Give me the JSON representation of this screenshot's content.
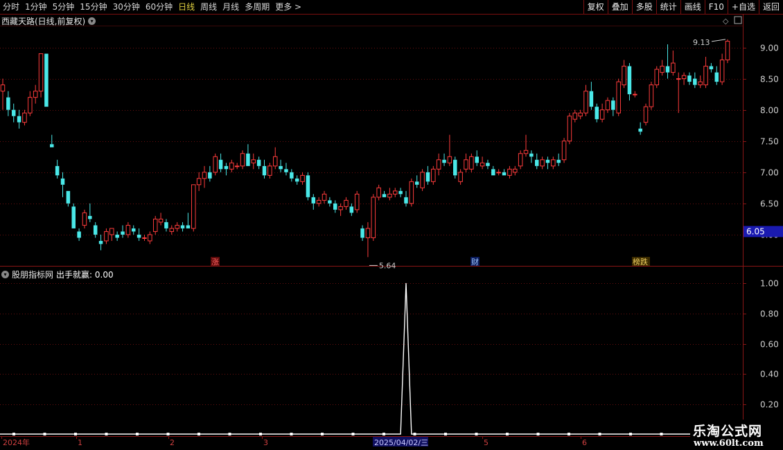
{
  "toolbar": {
    "periods": [
      "分时",
      "1分钟",
      "5分钟",
      "15分钟",
      "30分钟",
      "60分钟",
      "日线",
      "周线",
      "月线",
      "多周期",
      "更多 >"
    ],
    "active_period": "日线",
    "right_buttons": [
      "复权",
      "叠加",
      "多股",
      "统计",
      "画线",
      "F10",
      "+自选",
      "返回"
    ]
  },
  "main_title": "西藏天路(日线,前复权)",
  "indicator_title": "股朋指标网",
  "indicator_name": "出手就赢: 0.00",
  "price_axis": [
    "9.00",
    "8.50",
    "8.00",
    "7.50",
    "7.00",
    "6.50",
    "6.00"
  ],
  "current_price": "6.05",
  "high_label": "9.13",
  "low_label": "5.64",
  "markers": [
    "涨",
    "财",
    "榜跌"
  ],
  "ind_axis": [
    "1.00",
    "0.80",
    "0.60",
    "0.40",
    "0.20"
  ],
  "date_labels": [
    "2024年",
    "1",
    "2",
    "3",
    "2025/04/02/三",
    "5",
    "6"
  ],
  "logo": {
    "name": "乐淘公式网",
    "url": "www.60lt.com"
  },
  "colors": {
    "up": "#ff3c3c",
    "down": "#4ae8e8",
    "grid": "#6a0f0f",
    "bg": "#000000",
    "signal": "#ffffff"
  },
  "chart_data": {
    "type": "candlestick",
    "ohlc": [
      [
        8.3,
        8.5,
        8.0,
        8.4
      ],
      [
        8.2,
        8.3,
        7.9,
        8.0
      ],
      [
        8.0,
        8.1,
        7.8,
        7.9
      ],
      [
        7.9,
        8.0,
        7.7,
        7.8
      ],
      [
        7.8,
        8.0,
        7.75,
        7.95
      ],
      [
        7.95,
        8.3,
        7.9,
        8.2
      ],
      [
        8.2,
        8.4,
        8.1,
        8.3
      ],
      [
        8.3,
        8.9,
        8.2,
        8.9
      ],
      [
        8.9,
        8.9,
        8.05,
        8.05
      ],
      [
        7.45,
        7.6,
        7.4,
        7.4
      ],
      [
        7.1,
        7.2,
        6.9,
        6.95
      ],
      [
        6.9,
        7.0,
        6.6,
        6.8
      ],
      [
        6.7,
        6.7,
        6.45,
        6.5
      ],
      [
        6.45,
        6.5,
        6.1,
        6.1
      ],
      [
        6.05,
        6.1,
        5.9,
        5.95
      ],
      [
        6.15,
        6.4,
        6.1,
        6.35
      ],
      [
        6.3,
        6.5,
        6.2,
        6.25
      ],
      [
        6.15,
        6.2,
        5.95,
        6.0
      ],
      [
        5.9,
        6.0,
        5.75,
        5.85
      ],
      [
        5.9,
        6.1,
        5.85,
        6.05
      ],
      [
        6.0,
        6.1,
        5.9,
        6.1
      ],
      [
        6.0,
        6.05,
        5.9,
        5.95
      ],
      [
        6.05,
        6.15,
        5.95,
        6.0
      ],
      [
        6.0,
        6.2,
        5.95,
        6.15
      ],
      [
        6.1,
        6.15,
        6.0,
        6.05
      ],
      [
        6.0,
        6.1,
        5.9,
        5.95
      ],
      [
        5.95,
        6.0,
        5.9,
        5.95
      ],
      [
        5.9,
        6.05,
        5.85,
        6.0
      ],
      [
        6.05,
        6.3,
        6.0,
        6.25
      ],
      [
        6.2,
        6.35,
        6.15,
        6.25
      ],
      [
        6.2,
        6.25,
        6.05,
        6.1
      ],
      [
        6.05,
        6.15,
        6.0,
        6.1
      ],
      [
        6.1,
        6.2,
        6.05,
        6.15
      ],
      [
        6.15,
        6.2,
        6.05,
        6.1
      ],
      [
        6.15,
        6.35,
        6.1,
        6.1
      ],
      [
        6.1,
        6.8,
        6.05,
        6.8
      ],
      [
        6.8,
        7.0,
        6.7,
        6.9
      ],
      [
        6.9,
        7.1,
        6.75,
        7.0
      ],
      [
        7.0,
        7.1,
        6.85,
        6.9
      ],
      [
        7.0,
        7.3,
        6.95,
        7.25
      ],
      [
        7.2,
        7.3,
        7.0,
        7.05
      ],
      [
        7.1,
        7.15,
        6.95,
        7.05
      ],
      [
        7.05,
        7.2,
        7.0,
        7.15
      ],
      [
        7.1,
        7.15,
        7.05,
        7.1
      ],
      [
        7.1,
        7.35,
        7.05,
        7.3
      ],
      [
        7.3,
        7.45,
        7.1,
        7.1
      ],
      [
        7.15,
        7.3,
        7.05,
        7.2
      ],
      [
        7.2,
        7.25,
        7.05,
        7.1
      ],
      [
        7.1,
        7.2,
        6.9,
        6.95
      ],
      [
        6.95,
        7.15,
        6.9,
        7.1
      ],
      [
        7.1,
        7.4,
        7.05,
        7.25
      ],
      [
        7.1,
        7.2,
        7.0,
        7.05
      ],
      [
        7.05,
        7.15,
        6.95,
        7.0
      ],
      [
        7.0,
        7.05,
        6.85,
        6.9
      ],
      [
        6.9,
        6.95,
        6.8,
        6.85
      ],
      [
        6.85,
        7.0,
        6.8,
        6.95
      ],
      [
        6.95,
        7.0,
        6.55,
        6.6
      ],
      [
        6.6,
        6.65,
        6.4,
        6.5
      ],
      [
        6.5,
        6.6,
        6.45,
        6.55
      ],
      [
        6.55,
        6.7,
        6.5,
        6.65
      ],
      [
        6.55,
        6.6,
        6.45,
        6.5
      ],
      [
        6.5,
        6.55,
        6.35,
        6.4
      ],
      [
        6.4,
        6.5,
        6.3,
        6.45
      ],
      [
        6.45,
        6.6,
        6.4,
        6.55
      ],
      [
        6.45,
        6.5,
        6.3,
        6.35
      ],
      [
        6.4,
        6.7,
        6.35,
        6.65
      ],
      [
        6.1,
        6.15,
        5.9,
        5.95
      ],
      [
        5.95,
        6.2,
        5.64,
        6.1
      ],
      [
        5.95,
        6.65,
        5.9,
        6.6
      ],
      [
        6.6,
        6.8,
        6.55,
        6.75
      ],
      [
        6.65,
        6.7,
        6.6,
        6.6
      ],
      [
        6.6,
        6.75,
        6.55,
        6.65
      ],
      [
        6.65,
        6.75,
        6.6,
        6.7
      ],
      [
        6.7,
        6.75,
        6.6,
        6.65
      ],
      [
        6.6,
        6.7,
        6.45,
        6.5
      ],
      [
        6.5,
        6.9,
        6.45,
        6.85
      ],
      [
        6.85,
        6.95,
        6.75,
        6.8
      ],
      [
        6.75,
        7.05,
        6.7,
        7.0
      ],
      [
        7.0,
        7.1,
        6.8,
        6.85
      ],
      [
        6.85,
        7.1,
        6.8,
        7.05
      ],
      [
        7.05,
        7.3,
        6.95,
        7.2
      ],
      [
        7.2,
        7.3,
        7.1,
        7.15
      ],
      [
        7.15,
        7.6,
        7.1,
        7.25
      ],
      [
        7.2,
        7.25,
        6.9,
        6.95
      ],
      [
        6.85,
        7.05,
        6.8,
        7.0
      ],
      [
        7.05,
        7.3,
        7.0,
        7.2
      ],
      [
        7.05,
        7.3,
        7.0,
        7.25
      ],
      [
        7.25,
        7.35,
        7.1,
        7.15
      ],
      [
        7.1,
        7.25,
        7.05,
        7.15
      ],
      [
        7.15,
        7.2,
        7.05,
        7.1
      ],
      [
        7.05,
        7.1,
        6.95,
        6.95
      ],
      [
        7.0,
        7.05,
        6.95,
        7.0
      ],
      [
        7.0,
        7.05,
        6.95,
        6.95
      ],
      [
        6.95,
        7.1,
        6.9,
        7.05
      ],
      [
        7.0,
        7.1,
        6.95,
        7.05
      ],
      [
        7.1,
        7.35,
        7.05,
        7.3
      ],
      [
        7.3,
        7.6,
        7.25,
        7.35
      ],
      [
        7.3,
        7.35,
        7.15,
        7.25
      ],
      [
        7.2,
        7.3,
        7.05,
        7.1
      ],
      [
        7.1,
        7.25,
        7.05,
        7.2
      ],
      [
        7.2,
        7.25,
        7.05,
        7.15
      ],
      [
        7.1,
        7.25,
        7.05,
        7.2
      ],
      [
        7.2,
        7.3,
        7.1,
        7.15
      ],
      [
        7.2,
        7.55,
        7.15,
        7.5
      ],
      [
        7.5,
        7.95,
        7.45,
        7.9
      ],
      [
        7.85,
        8.0,
        7.8,
        7.95
      ],
      [
        7.9,
        8.0,
        7.85,
        7.95
      ],
      [
        7.95,
        8.4,
        7.9,
        8.3
      ],
      [
        8.3,
        8.45,
        8.0,
        8.05
      ],
      [
        8.05,
        8.1,
        7.8,
        7.85
      ],
      [
        7.85,
        8.1,
        7.8,
        8.0
      ],
      [
        8.0,
        8.2,
        7.95,
        8.15
      ],
      [
        8.15,
        8.2,
        7.9,
        8.0
      ],
      [
        7.95,
        8.5,
        7.9,
        8.45
      ],
      [
        8.4,
        8.8,
        8.35,
        8.7
      ],
      [
        8.7,
        8.75,
        8.15,
        8.25
      ],
      [
        8.25,
        8.3,
        8.2,
        8.25
      ],
      [
        7.7,
        7.8,
        7.6,
        7.65
      ],
      [
        7.8,
        8.1,
        7.75,
        8.05
      ],
      [
        8.05,
        8.45,
        8.0,
        8.4
      ],
      [
        8.4,
        8.7,
        8.35,
        8.65
      ],
      [
        8.6,
        8.8,
        8.55,
        8.7
      ],
      [
        8.7,
        9.05,
        8.5,
        8.6
      ],
      [
        8.6,
        8.95,
        8.55,
        8.75
      ],
      [
        8.5,
        8.6,
        7.95,
        8.5
      ],
      [
        8.5,
        8.6,
        8.4,
        8.55
      ],
      [
        8.55,
        8.6,
        8.4,
        8.45
      ],
      [
        8.5,
        8.6,
        8.35,
        8.4
      ],
      [
        8.4,
        8.55,
        8.35,
        8.45
      ],
      [
        8.4,
        8.85,
        8.35,
        8.7
      ],
      [
        8.7,
        8.75,
        8.6,
        8.65
      ],
      [
        8.6,
        8.7,
        8.4,
        8.45
      ],
      [
        8.45,
        8.9,
        8.4,
        8.8
      ],
      [
        8.8,
        9.13,
        8.75,
        9.1
      ]
    ],
    "ylim": [
      5.5,
      9.35
    ],
    "indicator": {
      "name": "出手就赢",
      "ylim": [
        0,
        1.05
      ],
      "signal_index": 74,
      "signal_value": 1.0
    }
  }
}
